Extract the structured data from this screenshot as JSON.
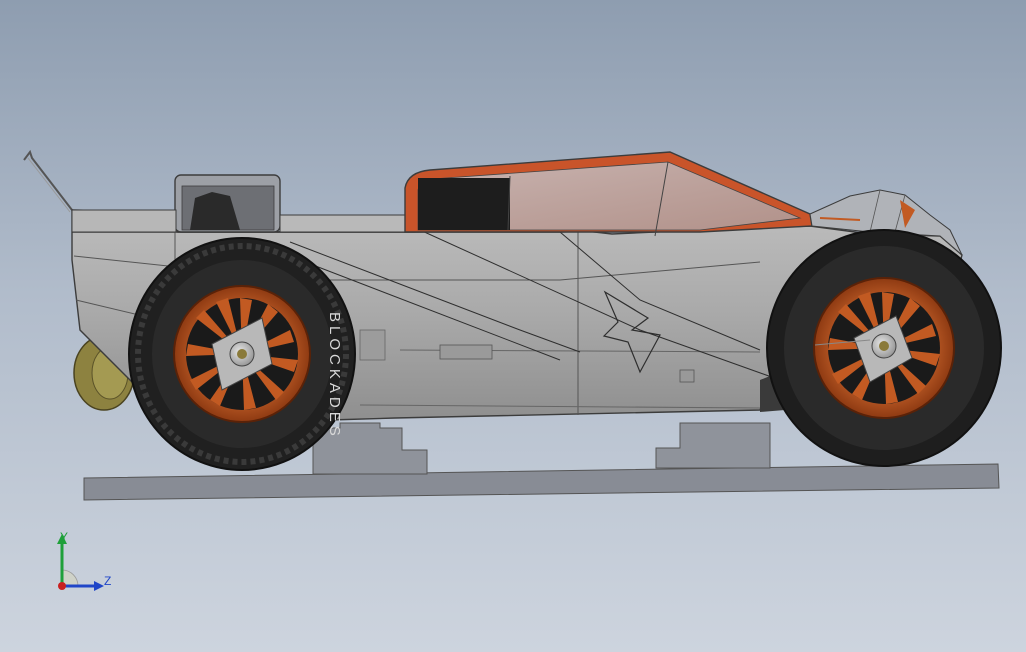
{
  "viewport": {
    "background_top": "#8e9db0",
    "background_bottom": "#cdd4de"
  },
  "model": {
    "body_color": "#a6a6a6",
    "accent_color": "#b5521f",
    "tire_color": "#262626",
    "rim_color": "#c25a22",
    "stand_color": "#8a8e96",
    "tire_text": "BLOCKADES"
  },
  "triad": {
    "y_label": "Y",
    "z_label": "Z",
    "y_color": "#1fa03a",
    "z_color": "#2046c8",
    "x_color": "#c82020"
  }
}
